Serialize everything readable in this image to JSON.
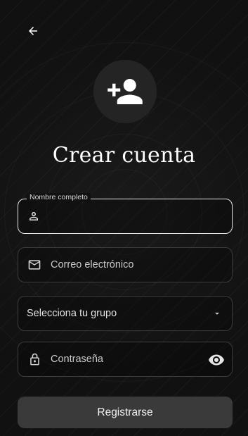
{
  "header": {
    "back_icon": "arrow-left-icon"
  },
  "avatar": {
    "icon": "person-add-icon"
  },
  "title": "Crear cuenta",
  "form": {
    "name": {
      "label": "Nombre completo",
      "value": "",
      "icon": "person-icon"
    },
    "email": {
      "placeholder": "Correo electrónico",
      "icon": "mail-icon"
    },
    "group": {
      "value": "Selecciona tu grupo",
      "icon": "dropdown-arrow-icon"
    },
    "password": {
      "placeholder": "Contraseña",
      "icon": "lock-icon",
      "toggle_icon": "eye-icon"
    }
  },
  "submit_label": "Registrarse",
  "colors": {
    "background": "#111111",
    "border": "#3c3c3c",
    "button": "#3a3a3a",
    "text": "#ffffff"
  }
}
